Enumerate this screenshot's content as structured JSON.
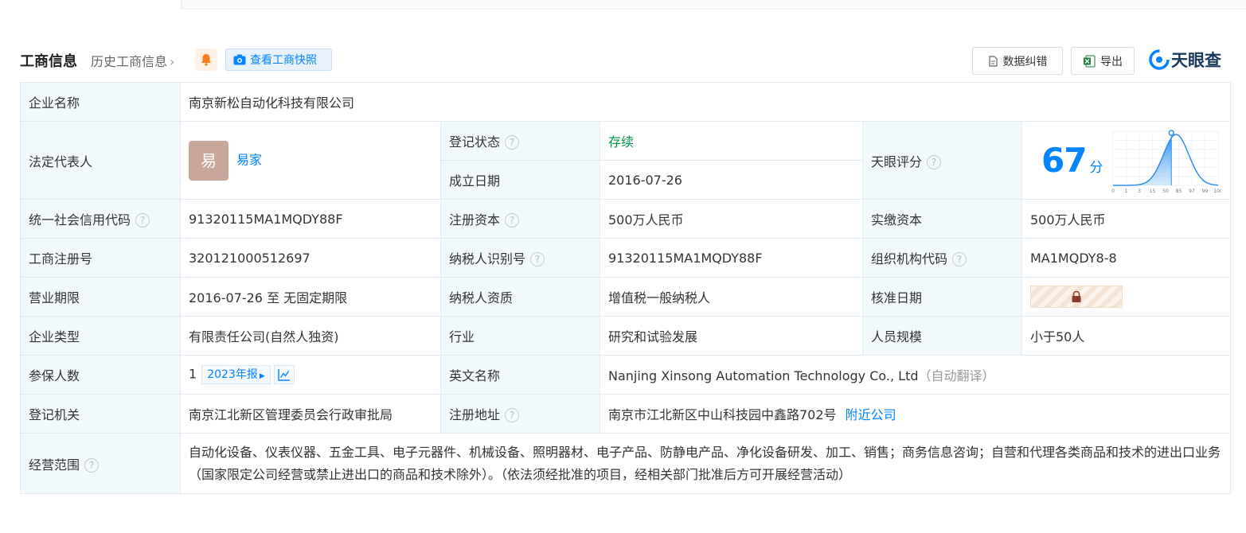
{
  "header": {
    "title": "工商信息",
    "history": "历史工商信息",
    "snapshot": "查看工商快照",
    "correct": "数据纠错",
    "export": "导出",
    "logo": "天眼查"
  },
  "labels": {
    "name": "企业名称",
    "legal": "法定代表人",
    "status": "登记状态",
    "founded": "成立日期",
    "score": "天眼评分",
    "credit": "统一社会信用代码",
    "capital": "注册资本",
    "paid": "实缴资本",
    "regno": "工商注册号",
    "taxid": "纳税人识别号",
    "orgcode": "组织机构代码",
    "term": "营业期限",
    "taxqual": "纳税人资质",
    "approve": "核准日期",
    "type": "企业类型",
    "industry": "行业",
    "staff": "人员规模",
    "insured": "参保人数",
    "english": "英文名称",
    "authority": "登记机关",
    "address": "注册地址",
    "scope": "经营范围"
  },
  "values": {
    "name": "南京新松自动化科技有限公司",
    "legal_avatar": "易",
    "legal_name": "易家",
    "status": "存续",
    "founded": "2016-07-26",
    "score": "67",
    "score_unit": "分",
    "credit": "91320115MA1MQDY88F",
    "capital": "500万人民币",
    "paid": "500万人民币",
    "regno": "320121000512697",
    "taxid": "91320115MA1MQDY88F",
    "orgcode": "MA1MQDY8-8",
    "term": "2016-07-26 至 无固定期限",
    "taxqual": "增值税一般纳税人",
    "type": "有限责任公司(自然人独资)",
    "industry": "研究和试验发展",
    "staff": "小于50人",
    "insured": "1",
    "insured_year": "2023年报",
    "english": "Nanjing Xinsong Automation Technology Co., Ltd",
    "english_note": "（自动翻译）",
    "authority": "南京江北新区管理委员会行政审批局",
    "address": "南京市江北新区中山科技园中鑫路702号",
    "nearby": "附近公司",
    "scope": "自动化设备、仪表仪器、五金工具、电子元器件、机械设备、照明器材、电子产品、防静电产品、净化设备研发、加工、销售；商务信息咨询；自营和代理各类商品和技术的进出口业务（国家限定公司经营或禁止进出口的商品和技术除外）。（依法须经批准的项目，经相关部门批准后方可开展经营活动）"
  },
  "score_chart": {
    "ticks": [
      "0",
      "1",
      "3",
      "15",
      "50",
      "85",
      "97",
      "99",
      "100"
    ],
    "marker_value": 67
  },
  "colors": {
    "accent": "#0084ff",
    "status_green": "#00964b",
    "label_bg": "#f2f9fc"
  }
}
